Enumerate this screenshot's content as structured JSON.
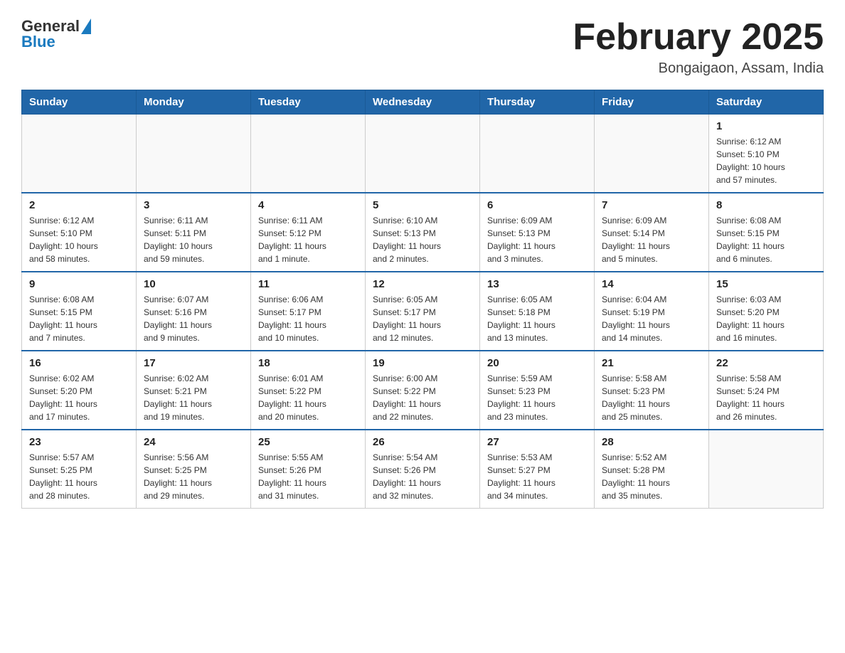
{
  "header": {
    "logo_general": "General",
    "logo_blue": "Blue",
    "month_title": "February 2025",
    "location": "Bongaigaon, Assam, India"
  },
  "weekdays": [
    "Sunday",
    "Monday",
    "Tuesday",
    "Wednesday",
    "Thursday",
    "Friday",
    "Saturday"
  ],
  "weeks": [
    [
      {
        "day": "",
        "info": ""
      },
      {
        "day": "",
        "info": ""
      },
      {
        "day": "",
        "info": ""
      },
      {
        "day": "",
        "info": ""
      },
      {
        "day": "",
        "info": ""
      },
      {
        "day": "",
        "info": ""
      },
      {
        "day": "1",
        "info": "Sunrise: 6:12 AM\nSunset: 5:10 PM\nDaylight: 10 hours\nand 57 minutes."
      }
    ],
    [
      {
        "day": "2",
        "info": "Sunrise: 6:12 AM\nSunset: 5:10 PM\nDaylight: 10 hours\nand 58 minutes."
      },
      {
        "day": "3",
        "info": "Sunrise: 6:11 AM\nSunset: 5:11 PM\nDaylight: 10 hours\nand 59 minutes."
      },
      {
        "day": "4",
        "info": "Sunrise: 6:11 AM\nSunset: 5:12 PM\nDaylight: 11 hours\nand 1 minute."
      },
      {
        "day": "5",
        "info": "Sunrise: 6:10 AM\nSunset: 5:13 PM\nDaylight: 11 hours\nand 2 minutes."
      },
      {
        "day": "6",
        "info": "Sunrise: 6:09 AM\nSunset: 5:13 PM\nDaylight: 11 hours\nand 3 minutes."
      },
      {
        "day": "7",
        "info": "Sunrise: 6:09 AM\nSunset: 5:14 PM\nDaylight: 11 hours\nand 5 minutes."
      },
      {
        "day": "8",
        "info": "Sunrise: 6:08 AM\nSunset: 5:15 PM\nDaylight: 11 hours\nand 6 minutes."
      }
    ],
    [
      {
        "day": "9",
        "info": "Sunrise: 6:08 AM\nSunset: 5:15 PM\nDaylight: 11 hours\nand 7 minutes."
      },
      {
        "day": "10",
        "info": "Sunrise: 6:07 AM\nSunset: 5:16 PM\nDaylight: 11 hours\nand 9 minutes."
      },
      {
        "day": "11",
        "info": "Sunrise: 6:06 AM\nSunset: 5:17 PM\nDaylight: 11 hours\nand 10 minutes."
      },
      {
        "day": "12",
        "info": "Sunrise: 6:05 AM\nSunset: 5:17 PM\nDaylight: 11 hours\nand 12 minutes."
      },
      {
        "day": "13",
        "info": "Sunrise: 6:05 AM\nSunset: 5:18 PM\nDaylight: 11 hours\nand 13 minutes."
      },
      {
        "day": "14",
        "info": "Sunrise: 6:04 AM\nSunset: 5:19 PM\nDaylight: 11 hours\nand 14 minutes."
      },
      {
        "day": "15",
        "info": "Sunrise: 6:03 AM\nSunset: 5:20 PM\nDaylight: 11 hours\nand 16 minutes."
      }
    ],
    [
      {
        "day": "16",
        "info": "Sunrise: 6:02 AM\nSunset: 5:20 PM\nDaylight: 11 hours\nand 17 minutes."
      },
      {
        "day": "17",
        "info": "Sunrise: 6:02 AM\nSunset: 5:21 PM\nDaylight: 11 hours\nand 19 minutes."
      },
      {
        "day": "18",
        "info": "Sunrise: 6:01 AM\nSunset: 5:22 PM\nDaylight: 11 hours\nand 20 minutes."
      },
      {
        "day": "19",
        "info": "Sunrise: 6:00 AM\nSunset: 5:22 PM\nDaylight: 11 hours\nand 22 minutes."
      },
      {
        "day": "20",
        "info": "Sunrise: 5:59 AM\nSunset: 5:23 PM\nDaylight: 11 hours\nand 23 minutes."
      },
      {
        "day": "21",
        "info": "Sunrise: 5:58 AM\nSunset: 5:23 PM\nDaylight: 11 hours\nand 25 minutes."
      },
      {
        "day": "22",
        "info": "Sunrise: 5:58 AM\nSunset: 5:24 PM\nDaylight: 11 hours\nand 26 minutes."
      }
    ],
    [
      {
        "day": "23",
        "info": "Sunrise: 5:57 AM\nSunset: 5:25 PM\nDaylight: 11 hours\nand 28 minutes."
      },
      {
        "day": "24",
        "info": "Sunrise: 5:56 AM\nSunset: 5:25 PM\nDaylight: 11 hours\nand 29 minutes."
      },
      {
        "day": "25",
        "info": "Sunrise: 5:55 AM\nSunset: 5:26 PM\nDaylight: 11 hours\nand 31 minutes."
      },
      {
        "day": "26",
        "info": "Sunrise: 5:54 AM\nSunset: 5:26 PM\nDaylight: 11 hours\nand 32 minutes."
      },
      {
        "day": "27",
        "info": "Sunrise: 5:53 AM\nSunset: 5:27 PM\nDaylight: 11 hours\nand 34 minutes."
      },
      {
        "day": "28",
        "info": "Sunrise: 5:52 AM\nSunset: 5:28 PM\nDaylight: 11 hours\nand 35 minutes."
      },
      {
        "day": "",
        "info": ""
      }
    ]
  ]
}
